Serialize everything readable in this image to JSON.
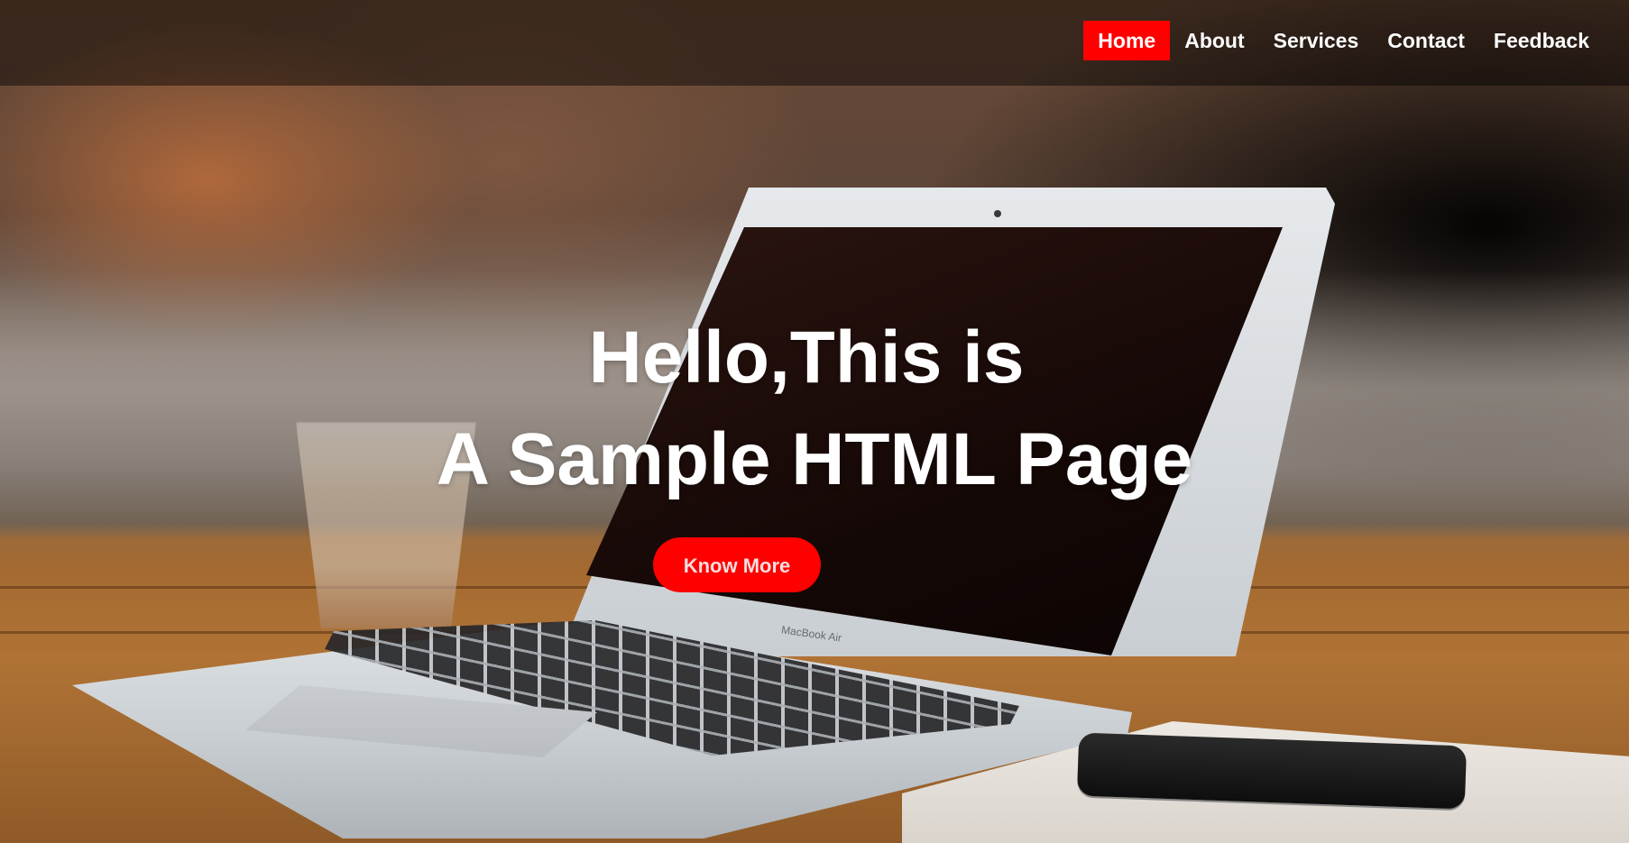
{
  "nav": {
    "items": [
      {
        "label": "Home",
        "active": true
      },
      {
        "label": "About",
        "active": false
      },
      {
        "label": "Services",
        "active": false
      },
      {
        "label": "Contact",
        "active": false
      },
      {
        "label": "Feedback",
        "active": false
      }
    ]
  },
  "hero": {
    "title_line1": "Hello,This is",
    "title_line2": "A Sample HTML Page",
    "cta_label": "Know More"
  },
  "background": {
    "laptop_label": "MacBook Air"
  },
  "colors": {
    "accent": "#ff0000",
    "text": "#ffffff",
    "navbar_overlay": "rgba(0,0,0,0.45)"
  }
}
